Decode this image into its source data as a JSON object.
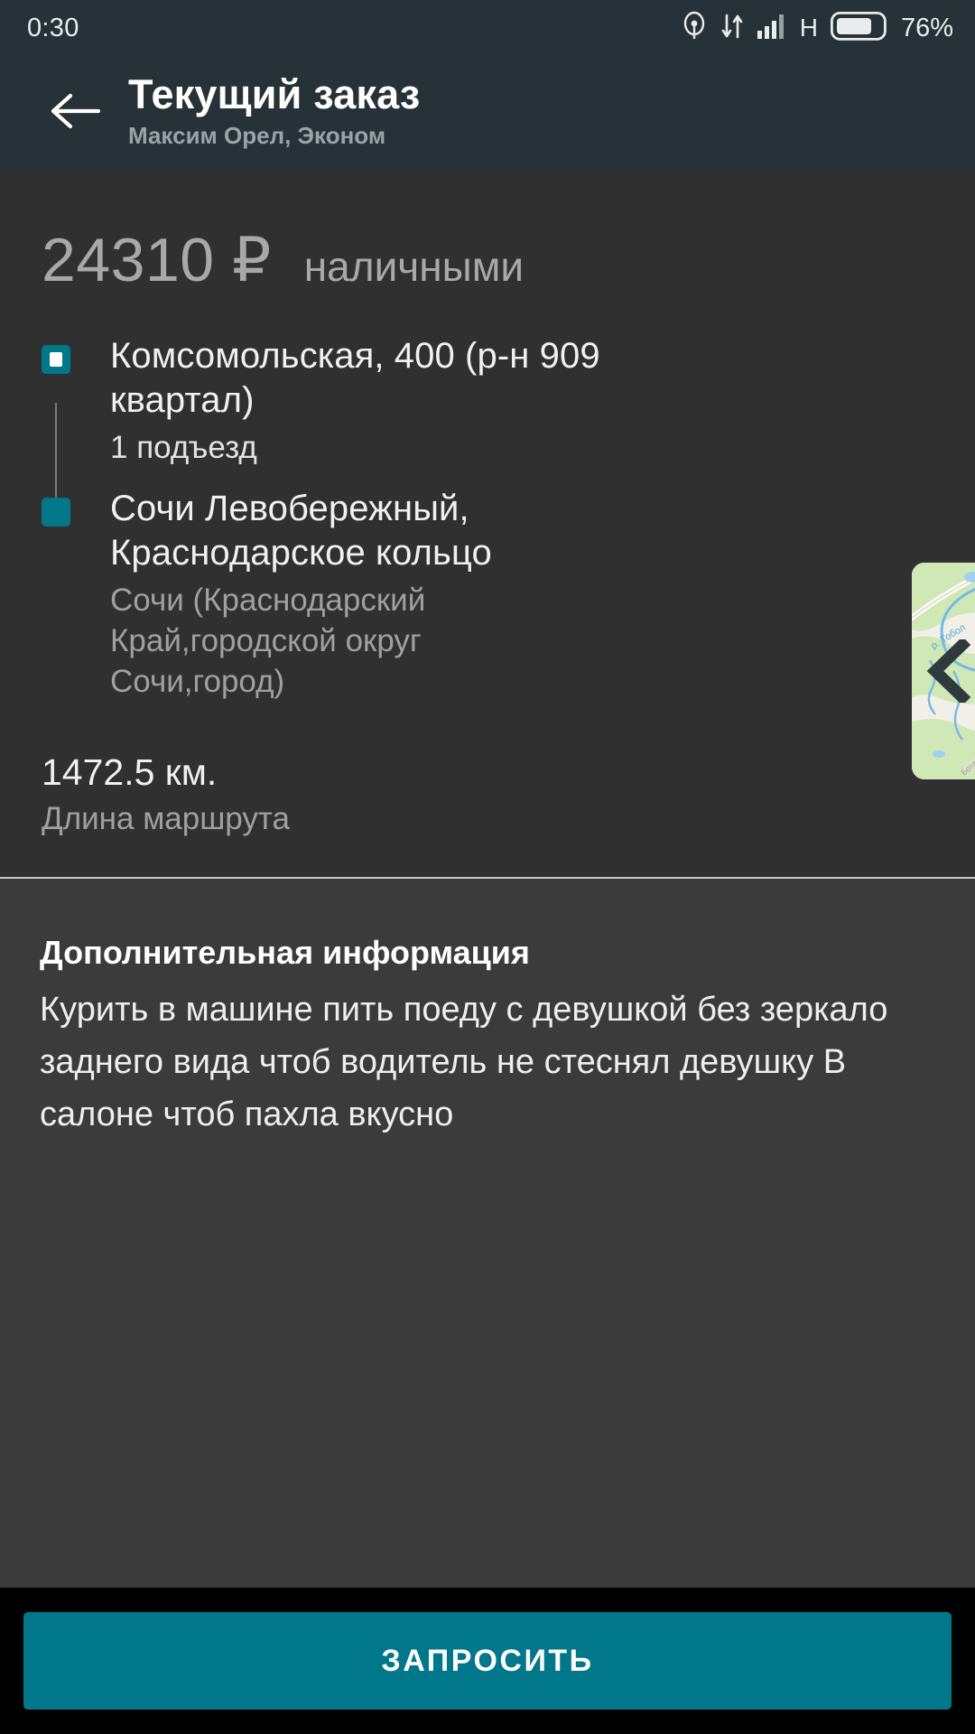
{
  "status_bar": {
    "time": "0:30",
    "network_type": "H",
    "battery_percent": "76%",
    "icons": {
      "location": "location-icon",
      "data_transfer": "data-transfer-icon",
      "signal": "signal-bars-icon",
      "battery": "battery-icon"
    }
  },
  "app_bar": {
    "back": "back-arrow-icon",
    "title": "Текущий заказ",
    "subtitle": "Максим Орел, Эконом"
  },
  "order": {
    "price_value": "24310 ₽",
    "payment_method": "наличными",
    "pickup": {
      "address": "Комсомольская, 400 (р-н 909 квартал)",
      "detail": "1 подъезд"
    },
    "destination": {
      "address": "Сочи Левобережный, Краснодарское кольцо",
      "region": "Сочи (Краснодарский Край,городской округ Сочи,город)"
    },
    "distance_value": "1472.5 км.",
    "distance_label": "Длина маршрута"
  },
  "map_peek": {
    "river_label": "р. Тобол",
    "road_label": "Ботаническое",
    "chevron": "chevron-left-icon"
  },
  "extra_info": {
    "title": "Дополнительная информация",
    "text": "Курить в машине пить поеду с девушкой без зеркало заднего вида чтоб водитель не стеснял девушку В салоне чтоб пахла вкусно"
  },
  "bottom_bar": {
    "request_label": "ЗАПРОСИТЬ"
  },
  "colors": {
    "appbar": "#263238",
    "accent_teal": "#00778a",
    "card_bg": "#303030",
    "page_bg": "#3b3b3b"
  }
}
